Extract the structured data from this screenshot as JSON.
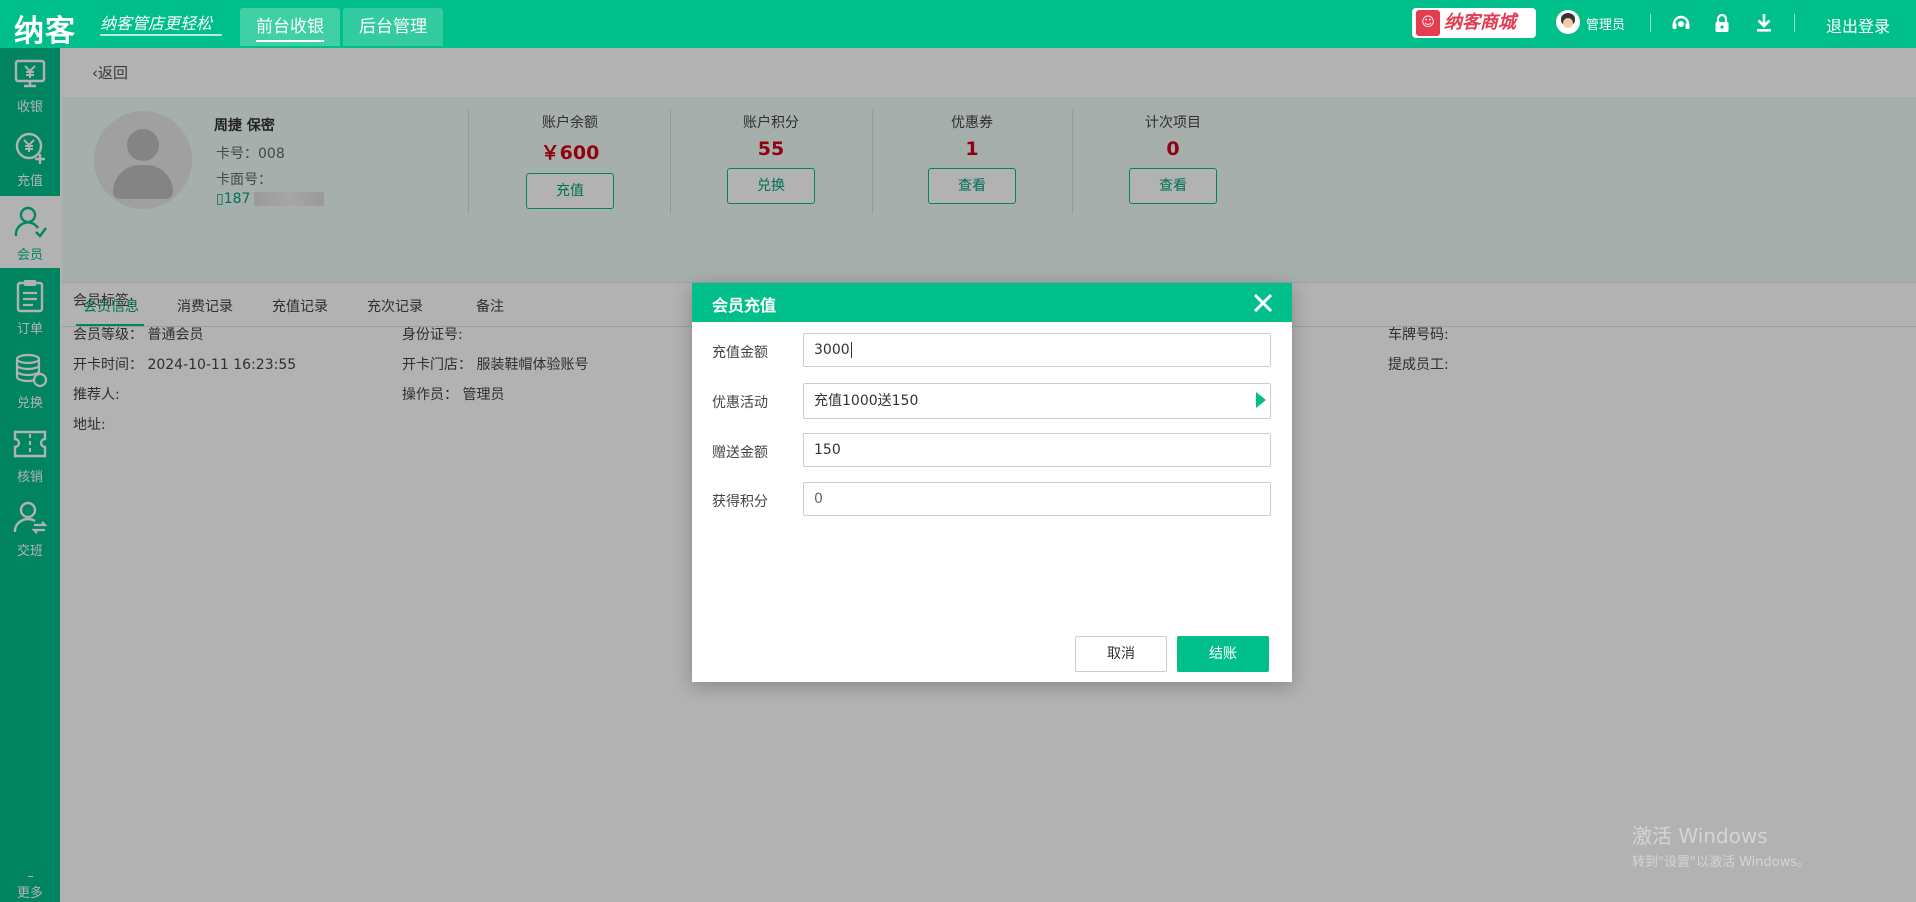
{
  "brand": {
    "logo": "纳客",
    "slogan": "纳客管店更轻松"
  },
  "topbar": {
    "tabs": [
      {
        "label": "前台收银",
        "active": true
      },
      {
        "label": "后台管理",
        "active": false
      }
    ],
    "mall_label": "纳客商城",
    "admin_label": "管理员",
    "icons": [
      "headset-icon",
      "lock-icon",
      "download-icon"
    ],
    "logout_label": "退出登录"
  },
  "sidebar": {
    "items": [
      {
        "label": "收银",
        "icon": "cashier-icon",
        "active": false
      },
      {
        "label": "充值",
        "icon": "recharge-icon",
        "active": false
      },
      {
        "label": "会员",
        "icon": "member-icon",
        "active": true
      },
      {
        "label": "订单",
        "icon": "order-icon",
        "active": false
      },
      {
        "label": "兑换",
        "icon": "exchange-icon",
        "active": false
      },
      {
        "label": "核销",
        "icon": "ticket-icon",
        "active": false
      },
      {
        "label": "交班",
        "icon": "handover-icon",
        "active": false
      }
    ],
    "more_label": "更多"
  },
  "page": {
    "back_label": "返回"
  },
  "member": {
    "name": "周捷 保密",
    "card_no": "卡号：008",
    "card_face": "卡面号：",
    "phone": "187"
  },
  "stats": [
    {
      "label": "账户余额",
      "value": "￥600",
      "button": "充值"
    },
    {
      "label": "账户积分",
      "value": "55",
      "button": "兑换"
    },
    {
      "label": "优惠券",
      "value": "1",
      "button": "查看"
    },
    {
      "label": "计次项目",
      "value": "0",
      "button": "查看"
    }
  ],
  "tabs": [
    {
      "label": "会员信息",
      "active": true
    },
    {
      "label": "消费记录",
      "active": false
    },
    {
      "label": "充值记录",
      "active": false
    },
    {
      "label": "充次记录",
      "active": false
    },
    {
      "label": "备注",
      "active": false
    }
  ],
  "info": {
    "tag": "会员标签:",
    "level": "会员等级：  普通会员",
    "open_time": "开卡时间：  2024-10-11 16:23:55",
    "referrer": "推荐人:",
    "address": "地址:",
    "id_no": "身份证号:",
    "open_store": "开卡门店：  服装鞋帽体验账号",
    "operator": "操作员：  管理员",
    "plate": "车牌号码:",
    "staff": "提成员工:"
  },
  "watermark": {
    "line1": "激活 Windows",
    "line2": "转到\"设置\"以激活 Windows。"
  },
  "dialog": {
    "title": "会员充值",
    "fields": [
      {
        "label": "充值金额",
        "value": "3000"
      },
      {
        "label": "优惠活动",
        "value": "充值1000送150"
      },
      {
        "label": "赠送金额",
        "value": "150"
      },
      {
        "label": "获得积分",
        "value": "0"
      }
    ],
    "cancel_label": "取消",
    "confirm_label": "结账"
  },
  "colors": {
    "primary": "#00bf8a",
    "value_red": "#d0021b",
    "mall_red": "#e63c52"
  }
}
